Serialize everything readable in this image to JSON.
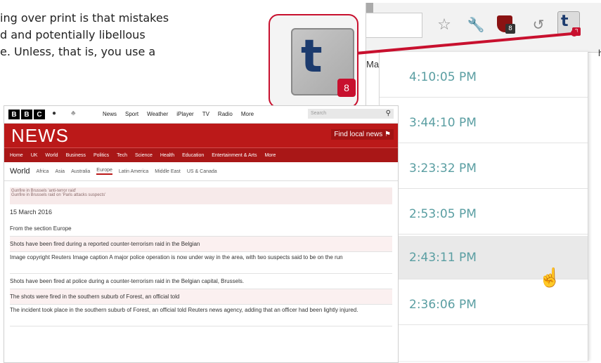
{
  "article_text": {
    "lines": [
      "ing over print is that mistakes",
      "d and potentially libellous",
      "e. Unless, that is, you use a"
    ]
  },
  "toolbar": {
    "tab_fragment_left": "Ma",
    "tab_fragment_right": "har",
    "icons": [
      "star-icon",
      "wrench-icon",
      "ublock-shield-icon",
      "history-icon",
      "t-extension-icon",
      "more-icon"
    ],
    "badge_text": "8"
  },
  "dropdown": {
    "items": [
      {
        "time": "4:10:05 PM"
      },
      {
        "time": "3:44:10 PM"
      },
      {
        "time": "3:23:32 PM"
      },
      {
        "time": "2:53:05 PM"
      },
      {
        "time": "2:43:11 PM"
      },
      {
        "time": "2:36:06 PM"
      }
    ],
    "hovered_index": 4,
    "time_color": "#5a9ea2"
  },
  "bbc": {
    "logo": [
      "B",
      "B",
      "C"
    ],
    "top_nav": [
      "News",
      "Sport",
      "Weather",
      "iPlayer",
      "TV",
      "Radio",
      "More"
    ],
    "search_placeholder": "Search",
    "title": "NEWS",
    "find_local": "Find local news",
    "main_nav": [
      "Home",
      "UK",
      "World",
      "Business",
      "Politics",
      "Tech",
      "Science",
      "Health",
      "Education",
      "Entertainment & Arts",
      "More"
    ],
    "sub_nav_title": "World",
    "sub_nav": [
      "Africa",
      "Asia",
      "Australia",
      "Europe",
      "Latin America",
      "Middle East",
      "US & Canada"
    ],
    "active_sub": "Europe",
    "notes": [
      "Gunfire in Brussels 'anti-terror raid'",
      "Gunfire in Brussels raid on 'Paris attacks suspects'"
    ],
    "date": "15 March 2016",
    "lines": [
      "From the section Europe",
      "Shots have been fired during a reported counter-terrorism raid in the Belgian",
      "Image copyright Reuters Image caption A major police operation is now under way in the area, with two suspects said to be on the run",
      "Shots have been fired at police during a counter-terrorism raid in the Belgian capital, Brussels.",
      "The shots were fired in the southern suburb of Forest, an official told",
      "The incident took place in the southern suburb of Forest, an official told Reuters news agency, adding that an officer had been lightly injured."
    ],
    "brand_red": "#bb1919"
  },
  "colors": {
    "callout_border": "#c8102e"
  }
}
